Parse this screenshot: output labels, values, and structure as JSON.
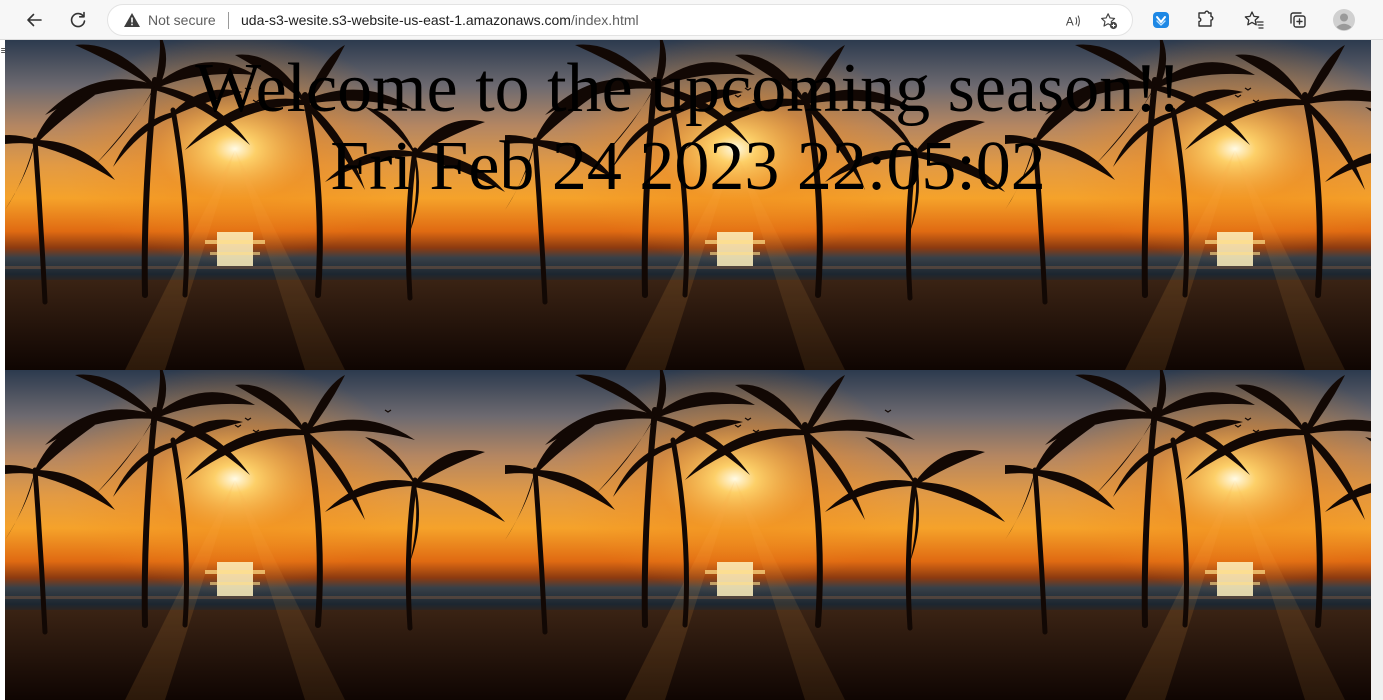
{
  "browser": {
    "security_label": "Not secure",
    "url_host": "uda-s3-wesite.s3-website-us-east-1.amazonaws.com",
    "url_path": "/index.html",
    "icons": [
      "back-icon",
      "refresh-icon",
      "warning-icon",
      "read-aloud-icon",
      "add-favorite-icon",
      "shield-extension-icon",
      "extensions-icon",
      "favorites-icon",
      "collections-icon",
      "profile-icon"
    ]
  },
  "page": {
    "heading": "Welcome to the upcoming season!!",
    "date": "Fri Feb 24 2023 22:05:02",
    "background_tiles": {
      "columns": 3,
      "rows": 2,
      "image": "sunset palm trees beach"
    }
  },
  "colors": {
    "sky_top": "#2c3a4e",
    "sun_glow": "#f5a22a",
    "silhouette": "#120804",
    "text": "#000000"
  }
}
